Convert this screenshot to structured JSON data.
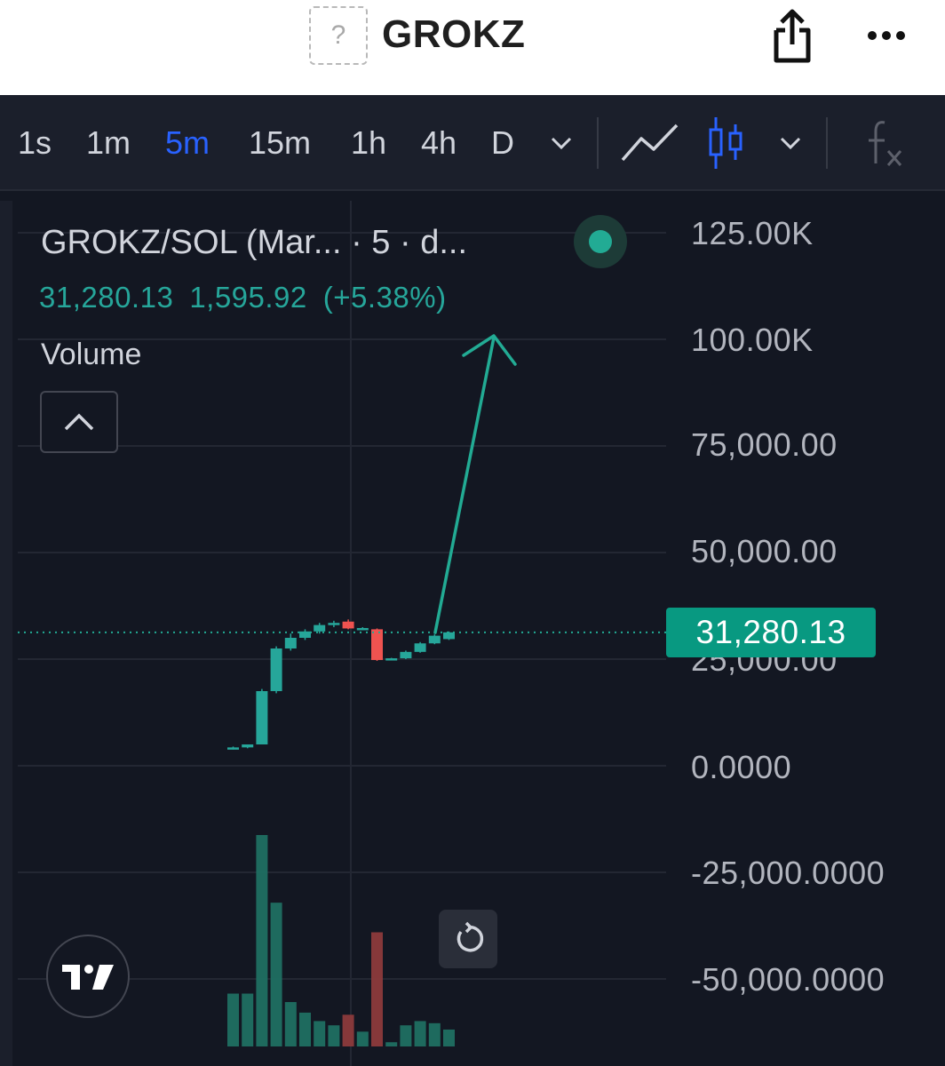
{
  "header": {
    "token_icon_glyph": "?",
    "token_name": "GROKZ"
  },
  "toolbar": {
    "timeframes": [
      {
        "label": "1s",
        "active": false
      },
      {
        "label": "1m",
        "active": false
      },
      {
        "label": "5m",
        "active": true
      },
      {
        "label": "15m",
        "active": false
      },
      {
        "label": "1h",
        "active": false
      },
      {
        "label": "4h",
        "active": false
      },
      {
        "label": "D",
        "active": false
      }
    ],
    "active_color": "#2962ff"
  },
  "legend": {
    "title": "GROKZ/SOL (Mar... · 5 · d...",
    "price": "31,280.13",
    "change": "1,595.92",
    "change_pct": "(+5.38%)",
    "volume_label": "Volume"
  },
  "price_axis": {
    "labels": [
      "125.00K",
      "100.00K",
      "75,000.00",
      "50,000.00",
      "25,000.00",
      "0.0000",
      "-25,000.0000",
      "-50,000.0000"
    ],
    "current_price_tag": "31,280.13"
  },
  "colors": {
    "up": "#26a69a",
    "down": "#ef5350",
    "background": "#131722",
    "price_tag": "#089981"
  },
  "chart_data": {
    "type": "candlestick",
    "interval": "5",
    "ylim": [
      -60000,
      130000
    ],
    "candles": [
      {
        "open": 4000,
        "high": 4500,
        "low": 3800,
        "close": 4300
      },
      {
        "open": 4300,
        "high": 4800,
        "low": 4100,
        "close": 5000
      },
      {
        "open": 5000,
        "high": 18000,
        "low": 5000,
        "close": 17500
      },
      {
        "open": 17500,
        "high": 28000,
        "low": 17000,
        "close": 27500
      },
      {
        "open": 27500,
        "high": 31000,
        "low": 27000,
        "close": 30000
      },
      {
        "open": 30000,
        "high": 32000,
        "low": 29500,
        "close": 31500
      },
      {
        "open": 31500,
        "high": 33500,
        "low": 31000,
        "close": 33000
      },
      {
        "open": 33000,
        "high": 34000,
        "low": 32500,
        "close": 33500
      },
      {
        "open": 33800,
        "high": 34300,
        "low": 32000,
        "close": 32200
      },
      {
        "open": 32200,
        "high": 32500,
        "low": 31800,
        "close": 32300
      },
      {
        "open": 32000,
        "high": 32200,
        "low": 24600,
        "close": 24800
      },
      {
        "open": 25000,
        "high": 25300,
        "low": 24800,
        "close": 25200
      },
      {
        "open": 25200,
        "high": 27000,
        "low": 25000,
        "close": 26700
      },
      {
        "open": 26700,
        "high": 29000,
        "low": 26500,
        "close": 28700
      },
      {
        "open": 28700,
        "high": 30800,
        "low": 28500,
        "close": 30500
      },
      {
        "open": 29700,
        "high": 31500,
        "low": 29500,
        "close": 31280.13
      }
    ],
    "volume_ratio": [
      0.25,
      0.25,
      1.0,
      0.68,
      0.21,
      0.16,
      0.12,
      0.1,
      0.15,
      0.07,
      0.54,
      0.02,
      0.1,
      0.12,
      0.11,
      0.08
    ],
    "last_price": 31280.13
  }
}
